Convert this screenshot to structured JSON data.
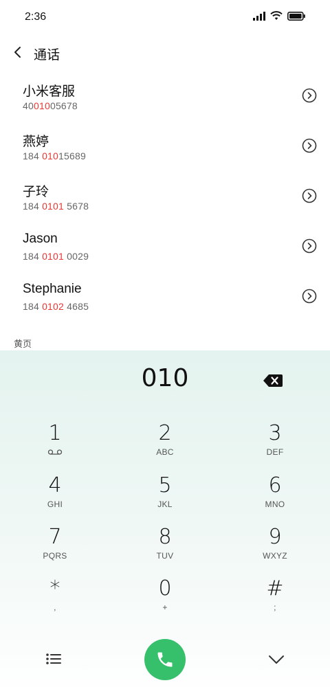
{
  "status_bar": {
    "time": "2:36"
  },
  "header": {
    "title": "通话"
  },
  "contacts": [
    {
      "name": "小米客服",
      "number_pre": "40",
      "number_hl": "010",
      "number_post": "05678"
    },
    {
      "name": "燕婷",
      "number_pre": "184 ",
      "number_hl": "010",
      "number_post": "15689"
    },
    {
      "name": "子玲",
      "number_pre": "184 ",
      "number_hl": "0101",
      "number_post": " 5678"
    },
    {
      "name": "Jason",
      "number_pre": "184 ",
      "number_hl": "0101",
      "number_post": " 0029"
    },
    {
      "name": "Stephanie",
      "number_pre": "184 ",
      "number_hl": "0102",
      "number_post": " 4685"
    }
  ],
  "section_label": "黄页",
  "dialpad": {
    "display": "010",
    "keys": [
      {
        "digit": "1",
        "sub": ""
      },
      {
        "digit": "2",
        "sub": "ABC"
      },
      {
        "digit": "3",
        "sub": "DEF"
      },
      {
        "digit": "4",
        "sub": "GHI"
      },
      {
        "digit": "5",
        "sub": "JKL"
      },
      {
        "digit": "6",
        "sub": "MNO"
      },
      {
        "digit": "7",
        "sub": "PQRS"
      },
      {
        "digit": "8",
        "sub": "TUV"
      },
      {
        "digit": "9",
        "sub": "WXYZ"
      },
      {
        "digit": "*",
        "sub": ","
      },
      {
        "digit": "0",
        "sub": "+"
      },
      {
        "digit": "#",
        "sub": ";"
      }
    ]
  },
  "colors": {
    "accent_call": "#36c06b",
    "highlight": "#e53935"
  },
  "icons": {
    "signal": "signal-icon",
    "wifi": "wifi-icon",
    "battery": "battery-icon",
    "back": "back-arrow-icon",
    "info": "chevron-circle-icon",
    "backspace": "backspace-icon",
    "voicemail": "voicemail-icon",
    "menu": "list-menu-icon",
    "call": "phone-icon",
    "collapse": "chevron-down-icon"
  }
}
